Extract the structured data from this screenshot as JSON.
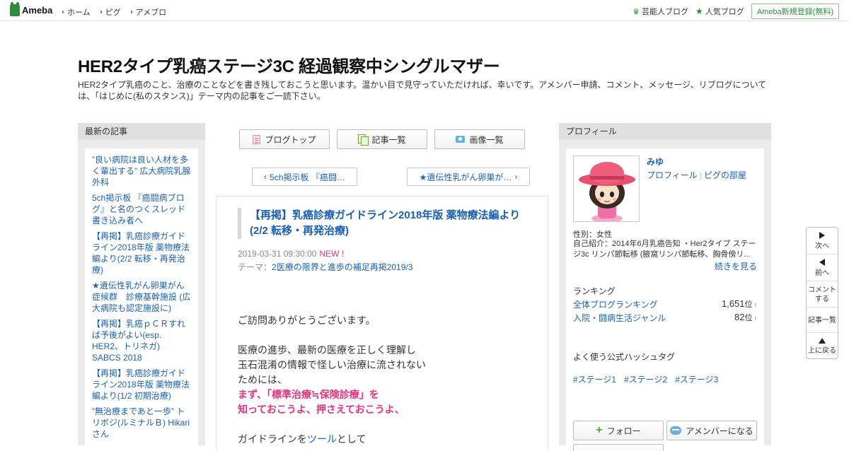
{
  "header": {
    "logo": "Ameba",
    "nav": [
      "ホーム",
      "ピグ",
      "アメブロ"
    ],
    "right": {
      "celebrity": "芸能人ブログ",
      "popular": "人気ブログ",
      "signup": "Ameba新規登録(無料)"
    }
  },
  "blog": {
    "title": "HER2タイプ乳癌ステージ3C 経過観察中シングルマザー",
    "description": "HER2タイプ乳癌のこと、治療のことなどを書き残しておこうと思います。温かい目で見守っていただければ、幸いです。アメンバー申請、コメント、メッセージ、リブログについては、「はじめに(私のスタンス)」テーマ内の記事をご一読下さい。"
  },
  "left_sidebar": {
    "heading": "最新の記事",
    "items": [
      "”良い病院は良い人材を多く輩出する” 広大病院乳腺外科",
      "5ch掲示板 『癌闘病ブログ』と名のつくスレッド書き込み者へ",
      "【再掲】乳癌診療ガイドライン2018年版 薬物療法編より(2/2 転移・再発治療)",
      "★遺伝性乳がん卵巣がん症候群　診療基幹施設 (広大病院も認定施設に)",
      "【再掲】乳癌ｐＣＲすれば予後がよい(esp. HER2、トリネガ) SABCS 2018",
      "【再掲】乳癌診療ガイドライン2018年版 薬物療法編より(1/2 初期治療)",
      "”無治療まであと一歩” トリボジ(ルミナルＢ) Hikariさん"
    ]
  },
  "center": {
    "buttons": {
      "top": "ブログトップ",
      "list": "記事一覧",
      "images": "画像一覧"
    },
    "pager": {
      "prev": "5ch掲示板 『癌闘…",
      "next": "★遺伝性乳がん卵巣が…"
    },
    "article": {
      "title": "【再掲】乳癌診療ガイドライン2018年版 薬物療法編より(2/2 転移・再発治療)",
      "date": "2019-03-31 09:30:00",
      "new_badge": "NEW !",
      "theme_label": "テーマ：",
      "theme": "2医療の限界と進歩の補足再掲2019/3",
      "body": {
        "line1": "ご訪問ありがとうございます。",
        "line2": "医療の進歩、最新の医療を正しく理解し",
        "line3": "玉石混淆の情報で怪しい治療に流されない",
        "line4": "ためには、",
        "pink1": "まず、「標準治療≒保険診療」を",
        "pink2": "知っておこうよ、押さえておこうよ、",
        "line5_pre": "ガイドラインを",
        "line5_link": "ツール",
        "line5_post": "として"
      }
    }
  },
  "right_sidebar": {
    "heading": "プロフィール",
    "name": "みゆ",
    "links": [
      "プロフィール",
      "ピグの部屋"
    ],
    "gender": "性別：女性",
    "intro": "自己紹介：2014年6月乳癌告知 ・Her2タイプ ステージ3c リンパ節転移 (腋窩リンパ節転移、胸骨傍リ...",
    "more": "続きを見る",
    "ranking_heading": "ランキング",
    "rankings": [
      {
        "label": "全体ブログランキング",
        "value": "1,651",
        "unit": "位",
        "arrow": "↑"
      },
      {
        "label": "入院・闘病生活ジャンル",
        "value": "82",
        "unit": "位",
        "arrow": "↑"
      }
    ],
    "hashtag_heading": "よく使う公式ハッシュタグ",
    "hashtags": [
      "#ステージ1",
      "#ステージ2",
      "#ステージ3"
    ],
    "follow": "フォロー",
    "member": "アメンバーになる"
  },
  "float_nav": {
    "next": "次へ",
    "prev": "前へ",
    "comment": "コメントする",
    "list": "記事一覧",
    "top": "上に戻る"
  },
  "colors": {
    "brand_green": "#2d8c3c",
    "link": "#1a5fb4",
    "pink": "#e2347e"
  }
}
